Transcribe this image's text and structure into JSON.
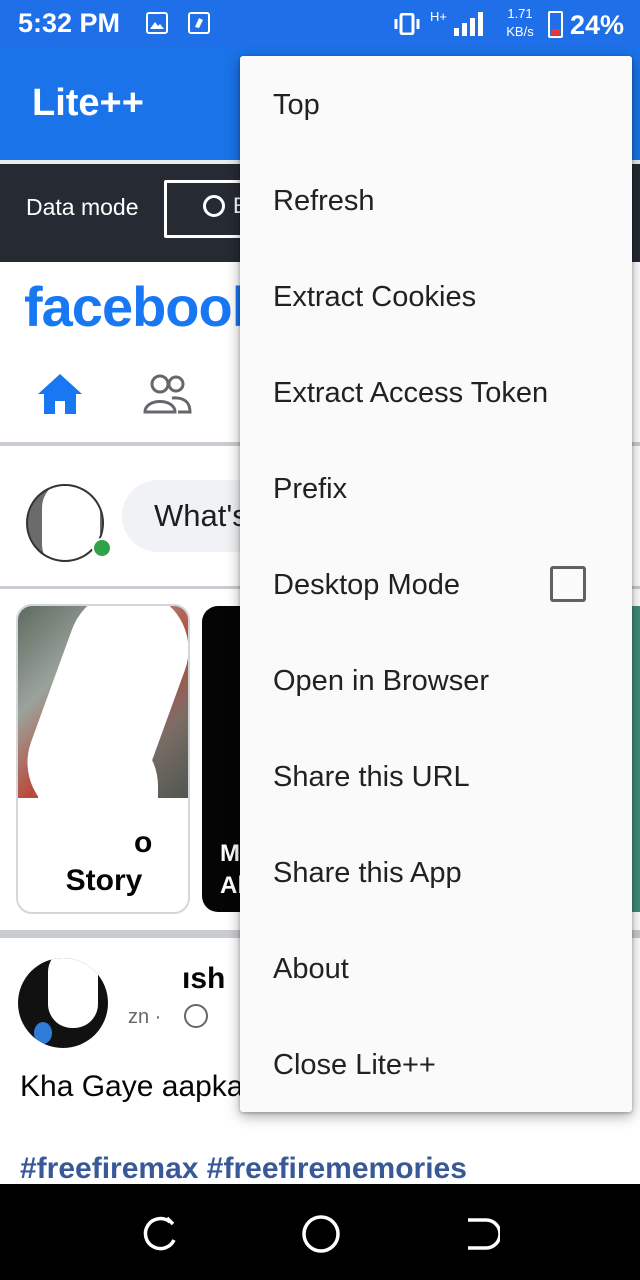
{
  "status_bar": {
    "time": "5:32 PM",
    "network_type": "H+",
    "speed_value": "1.71",
    "speed_unit": "KB/s",
    "battery_percent": "24%",
    "icons": [
      "gallery-icon",
      "notification-app-icon",
      "vibrate-icon",
      "signal-icon",
      "battery-icon"
    ]
  },
  "app_bar": {
    "title": "Lite++"
  },
  "data_bar": {
    "label": "Data mode",
    "mode_button_partial": "E"
  },
  "facebook": {
    "logo": "facebook",
    "composer_placeholder_partial": "What's",
    "stories": {
      "create_label_partial": "Story",
      "create_label_top_partial": "o",
      "second_story_partial_lines": [
        "M",
        "Al"
      ]
    },
    "post": {
      "author_partial": "ısh",
      "time_partial": "zn ·",
      "text_partial": "Kha Gaye aapka",
      "hashtags": "#freefiremax #freefirememories"
    }
  },
  "menu": {
    "items": [
      {
        "label": "Top"
      },
      {
        "label": "Refresh"
      },
      {
        "label": "Extract Cookies"
      },
      {
        "label": "Extract Access Token"
      },
      {
        "label": "Prefix"
      },
      {
        "label": "Desktop Mode",
        "checked": false
      },
      {
        "label": "Open in Browser"
      },
      {
        "label": "Share this URL"
      },
      {
        "label": "Share this App"
      },
      {
        "label": "About"
      },
      {
        "label": "Close Lite++"
      }
    ]
  },
  "nav_bar": {
    "buttons": [
      "recents-button",
      "home-button",
      "back-button"
    ]
  },
  "colors": {
    "status_bar": "#1e6fe8",
    "app_bar": "#1a73e8",
    "data_bar": "#262a33",
    "facebook_blue": "#1877f2",
    "hashtag": "#385898",
    "menu_bg": "#fafafa"
  }
}
